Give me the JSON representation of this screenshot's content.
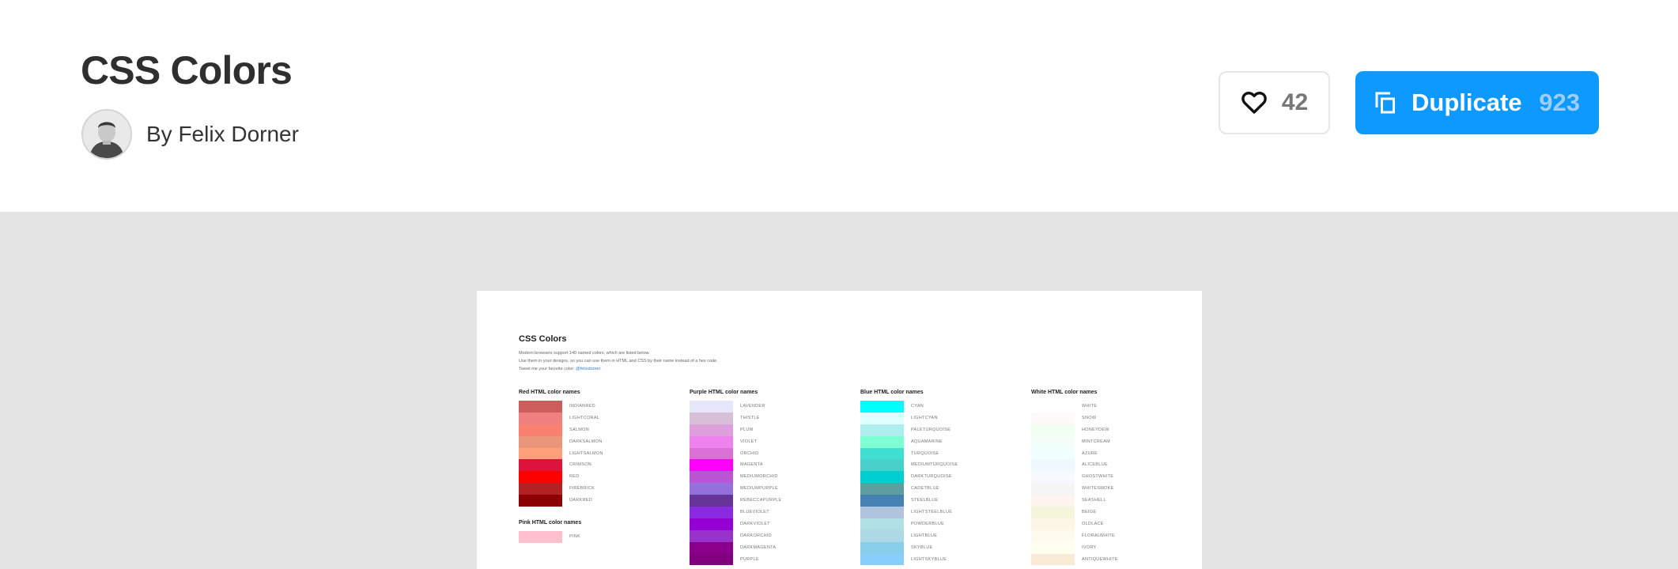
{
  "header": {
    "title": "CSS Colors",
    "author": "By Felix Dorner",
    "like_count": "42",
    "duplicate_label": "Duplicate",
    "duplicate_count": "923"
  },
  "preview": {
    "title": "CSS Colors",
    "intro": [
      "Modern browsers support 140 named colors, which are listed below.",
      "Use them in your designs, so you can use them in HTML and CSS by their name instead of a hex code.",
      "Tweet me your favorite color: "
    ],
    "intro_link": "@felixdorner",
    "columns": [
      {
        "title": "Red HTML color names",
        "swatches": [
          {
            "name": "INDIANRED",
            "color": "#cd5c5c"
          },
          {
            "name": "LIGHTCORAL",
            "color": "#f08080"
          },
          {
            "name": "SALMON",
            "color": "#fa8072"
          },
          {
            "name": "DARKSALMON",
            "color": "#e9967a"
          },
          {
            "name": "LIGHTSALMON",
            "color": "#ffa07a"
          },
          {
            "name": "CRIMSON",
            "color": "#dc143c"
          },
          {
            "name": "RED",
            "color": "#ff0000"
          },
          {
            "name": "FIREBRICK",
            "color": "#b22222"
          },
          {
            "name": "DARKRED",
            "color": "#8b0000"
          }
        ],
        "section2_title": "Pink HTML color names",
        "section2_swatches": [
          {
            "name": "PINK",
            "color": "#ffc0cb"
          }
        ]
      },
      {
        "title": "Purple HTML color names",
        "swatches": [
          {
            "name": "LAVENDER",
            "color": "#e6e6fa"
          },
          {
            "name": "THISTLE",
            "color": "#d8bfd8"
          },
          {
            "name": "PLUM",
            "color": "#dda0dd"
          },
          {
            "name": "VIOLET",
            "color": "#ee82ee"
          },
          {
            "name": "ORCHID",
            "color": "#da70d6"
          },
          {
            "name": "MAGENTA",
            "color": "#ff00ff"
          },
          {
            "name": "MEDIUMORCHID",
            "color": "#ba55d3"
          },
          {
            "name": "MEDIUMPURPLE",
            "color": "#9370db"
          },
          {
            "name": "REBECCAPURPLE",
            "color": "#663399"
          },
          {
            "name": "BLUEVIOLET",
            "color": "#8a2be2"
          },
          {
            "name": "DARKVIOLET",
            "color": "#9400d3"
          },
          {
            "name": "DARKORCHID",
            "color": "#9932cc"
          },
          {
            "name": "DARKMAGENTA",
            "color": "#8b008b"
          },
          {
            "name": "PURPLE",
            "color": "#800080"
          }
        ]
      },
      {
        "title": "Blue HTML color names",
        "swatches": [
          {
            "name": "CYAN",
            "color": "#00ffff"
          },
          {
            "name": "LIGHTCYAN",
            "color": "#e0ffff"
          },
          {
            "name": "PALETURQUOISE",
            "color": "#afeeee"
          },
          {
            "name": "AQUAMARINE",
            "color": "#7fffd4"
          },
          {
            "name": "TURQUOISE",
            "color": "#40e0d0"
          },
          {
            "name": "MEDIUMTURQUOISE",
            "color": "#48d1cc"
          },
          {
            "name": "DARKTURQUOISE",
            "color": "#00ced1"
          },
          {
            "name": "CADETBLUE",
            "color": "#5f9ea0"
          },
          {
            "name": "STEELBLUE",
            "color": "#4682b4"
          },
          {
            "name": "LIGHTSTEELBLUE",
            "color": "#b0c4de"
          },
          {
            "name": "POWDERBLUE",
            "color": "#b0e0e6"
          },
          {
            "name": "LIGHTBLUE",
            "color": "#add8e6"
          },
          {
            "name": "SKYBLUE",
            "color": "#87ceeb"
          },
          {
            "name": "LIGHTSKYBLUE",
            "color": "#87cefa"
          }
        ]
      },
      {
        "title": "White HTML color names",
        "swatches": [
          {
            "name": "WHITE",
            "color": "#ffffff"
          },
          {
            "name": "SNOW",
            "color": "#fffafa"
          },
          {
            "name": "HONEYDEW",
            "color": "#f0fff0"
          },
          {
            "name": "MINTCREAM",
            "color": "#f5fffa"
          },
          {
            "name": "AZURE",
            "color": "#f0ffff"
          },
          {
            "name": "ALICEBLUE",
            "color": "#f0f8ff"
          },
          {
            "name": "GHOSTWHITE",
            "color": "#f8f8ff"
          },
          {
            "name": "WHITESMOKE",
            "color": "#f5f5f5"
          },
          {
            "name": "SEASHELL",
            "color": "#fff5ee"
          },
          {
            "name": "BEIGE",
            "color": "#f5f5dc"
          },
          {
            "name": "OLDLACE",
            "color": "#fdf5e6"
          },
          {
            "name": "FLORALWHITE",
            "color": "#fffaf0"
          },
          {
            "name": "IVORY",
            "color": "#fffff0"
          },
          {
            "name": "ANTIQUEWHITE",
            "color": "#faebd7"
          }
        ]
      }
    ]
  },
  "colors": {
    "accent": "#0d99ff",
    "canvas_bg": "#e4e4e4"
  },
  "icons": {
    "like": "heart-icon",
    "duplicate": "duplicate-icon"
  }
}
